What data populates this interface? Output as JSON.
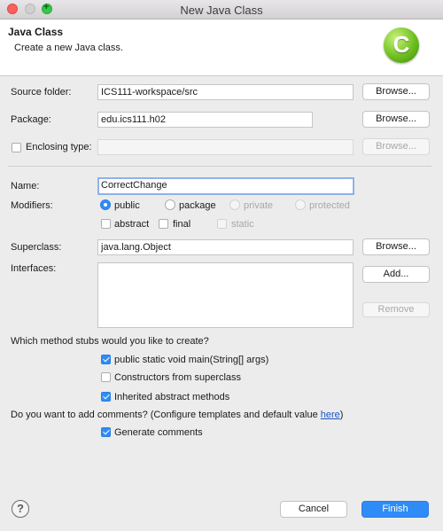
{
  "window": {
    "title": "New Java Class"
  },
  "banner": {
    "heading": "Java Class",
    "subtitle": "Create a new Java class.",
    "logo_letter": "C"
  },
  "source_folder": {
    "label": "Source folder:",
    "value": "ICS111-workspace/src",
    "browse": "Browse..."
  },
  "package": {
    "label": "Package:",
    "value": "edu.ics111.h02",
    "browse": "Browse..."
  },
  "enclosing": {
    "label": "Enclosing type:",
    "value": "",
    "browse": "Browse...",
    "checked": false
  },
  "name": {
    "label": "Name:",
    "value": "CorrectChange"
  },
  "modifiers": {
    "label": "Modifiers:",
    "public": "public",
    "package": "package",
    "private": "private",
    "protected": "protected",
    "abstract": "abstract",
    "final": "final",
    "static": "static",
    "selected": "public"
  },
  "superclass": {
    "label": "Superclass:",
    "value": "java.lang.Object",
    "browse": "Browse..."
  },
  "interfaces": {
    "label": "Interfaces:",
    "add": "Add...",
    "remove": "Remove"
  },
  "stubs": {
    "question": "Which method stubs would you like to create?",
    "main": "public static void main(String[] args)",
    "constructors": "Constructors from superclass",
    "inherited": "Inherited abstract methods",
    "main_checked": true,
    "constructors_checked": false,
    "inherited_checked": true
  },
  "comments": {
    "question_prefix": "Do you want to add comments? (Configure templates and default value ",
    "question_link": "here",
    "question_suffix": ")",
    "generate": "Generate comments",
    "generate_checked": true
  },
  "footer": {
    "help": "?",
    "cancel": "Cancel",
    "finish": "Finish"
  }
}
